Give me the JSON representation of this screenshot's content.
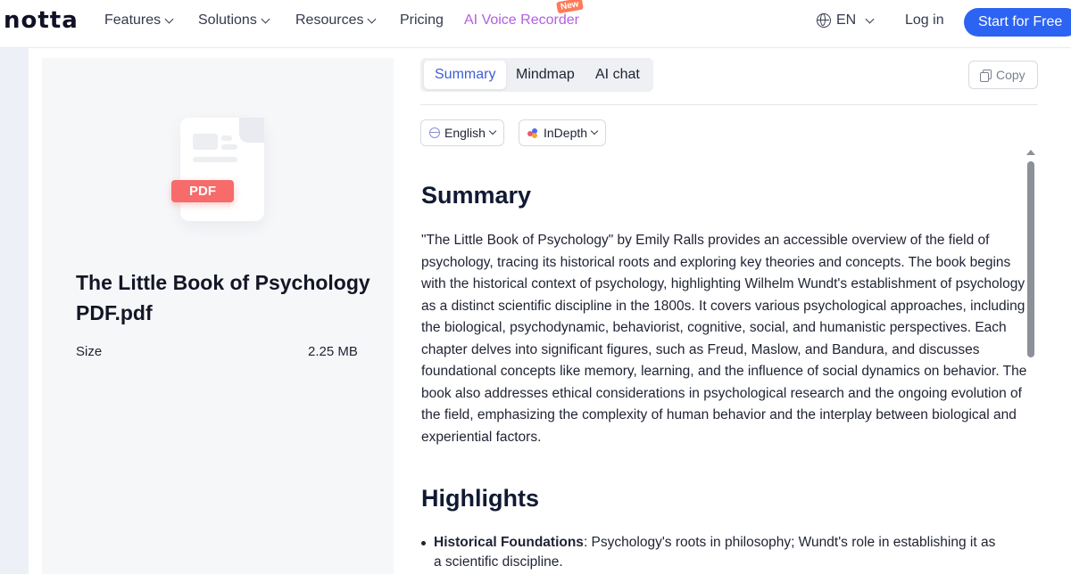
{
  "nav": {
    "logo": "notta",
    "items": [
      {
        "label": "Features"
      },
      {
        "label": "Solutions"
      },
      {
        "label": "Resources"
      },
      {
        "label": "Pricing"
      },
      {
        "label": "AI Voice Recorder"
      }
    ],
    "new_badge": "New",
    "language": "EN",
    "login": "Log in",
    "cta": "Start for Free"
  },
  "file": {
    "icon_label": "PDF",
    "title": "The Little Book of Psychology PDF.pdf",
    "size_label": "Size",
    "size_value": "2.25 MB"
  },
  "tabs": [
    {
      "label": "Summary",
      "active": true
    },
    {
      "label": "Mindmap",
      "active": false
    },
    {
      "label": "AI chat",
      "active": false
    }
  ],
  "copy_label": "Copy",
  "dropdowns": {
    "language": "English",
    "mode": "InDepth"
  },
  "content": {
    "summary_heading": "Summary",
    "summary_text": "\"The Little Book of Psychology\" by Emily Ralls provides an accessible overview of the field of psychology, tracing its historical roots and exploring key theories and concepts. The book begins with the historical context of psychology, highlighting Wilhelm Wundt's establishment of psychology as a distinct scientific discipline in the 1800s. It covers various psychological approaches, including the biological, psychodynamic, behaviorist, cognitive, social, and humanistic perspectives. Each chapter delves into significant figures, such as Freud, Maslow, and Bandura, and discusses foundational concepts like memory, learning, and the influence of social dynamics on behavior. The book also addresses ethical considerations in psychological research and the ongoing evolution of the field, emphasizing the complexity of human behavior and the interplay between biological and experiential factors.",
    "highlights_heading": "Highlights",
    "highlights": [
      {
        "title": "Historical Foundations",
        "text": ": Psychology's roots in philosophy; Wundt's role in establishing it as a scientific discipline."
      }
    ]
  }
}
